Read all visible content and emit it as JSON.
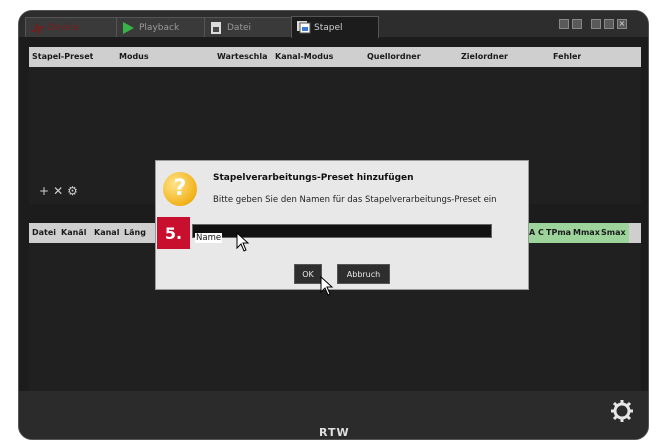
{
  "tabs": [
    {
      "label": "Device",
      "icon": "waveform-icon"
    },
    {
      "label": "Playback",
      "icon": "play-icon"
    },
    {
      "label": "Datei",
      "icon": "file-icon"
    },
    {
      "label": "Stapel",
      "icon": "stack-icon"
    }
  ],
  "preset_table": {
    "columns": [
      "Stapel-Preset",
      "Modus",
      "Warteschla",
      "Kanal-Modus",
      "Quellordner",
      "Zielordner",
      "Fehler"
    ]
  },
  "toolbar": {
    "add": "+",
    "remove": "✕",
    "settings": "⚙"
  },
  "file_table": {
    "columns": [
      "Datei",
      "Kanäl",
      "Kanal",
      "Läng"
    ],
    "right_columns": [
      "A C",
      "TPma",
      "Mmax",
      "Smax"
    ]
  },
  "dialog": {
    "title": "Stapelverarbeitungs-Preset hinzufügen",
    "message": "Bitte geben Sie den Namen für das Stapelverarbeitungs-Preset ein",
    "input_value": "Name",
    "ok_label": "OK",
    "cancel_label": "Abbruch"
  },
  "step_badge": "5.",
  "brand": "RTW",
  "colors": {
    "accent_red": "#c8102e",
    "question_icon": "#f2b21a"
  }
}
